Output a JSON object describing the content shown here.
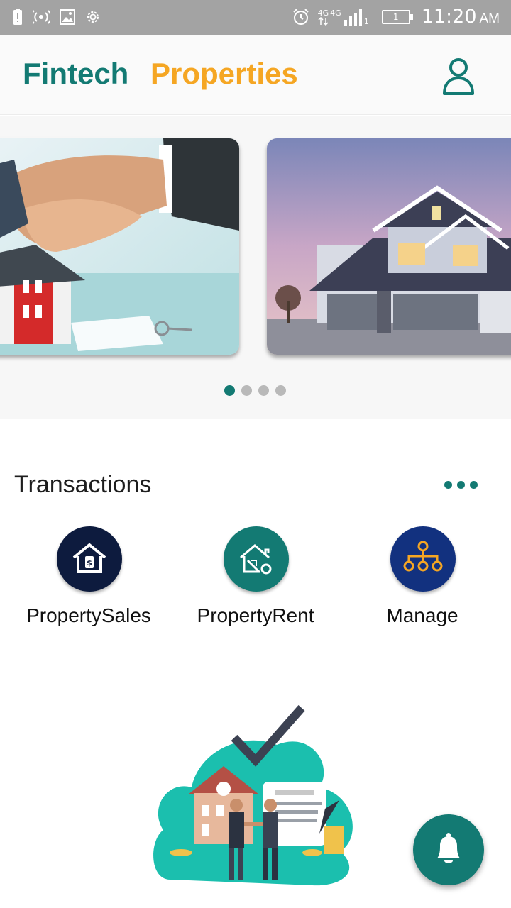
{
  "status_bar": {
    "time": "11:20",
    "ampm": "AM",
    "network_1": "4G",
    "network_2": "4G",
    "sim_slot": "1",
    "battery_level": "1",
    "icons": [
      "battery-alert-icon",
      "hotspot-icon",
      "image-icon",
      "settings-icon",
      "alarm-icon",
      "signal-icon",
      "battery-icon"
    ]
  },
  "header": {
    "brand_primary": "Fintech",
    "brand_secondary": "Properties",
    "brand_primary_color": "#137a73",
    "brand_secondary_color": "#f5a623",
    "profile_icon": "person-icon"
  },
  "carousel": {
    "slides": [
      {
        "image": "handshake-house-model-keys"
      },
      {
        "image": "suburban-house-dusk"
      }
    ],
    "page_count": 4,
    "active_index": 0
  },
  "transactions": {
    "title": "Transactions",
    "more_icon": "more-horizontal-icon",
    "items": [
      {
        "label": "PropertySales",
        "icon": "house-dollar-icon",
        "color": "#0d1b3e"
      },
      {
        "label": "PropertyRent",
        "icon": "house-key-icon",
        "color": "#137a73"
      },
      {
        "label": "Manage",
        "icon": "hierarchy-icon",
        "color": "#12317f"
      }
    ]
  },
  "illustration": {
    "image": "property-deal-handshake-illustration"
  },
  "fab": {
    "icon": "bell-icon",
    "color": "#137a73"
  }
}
